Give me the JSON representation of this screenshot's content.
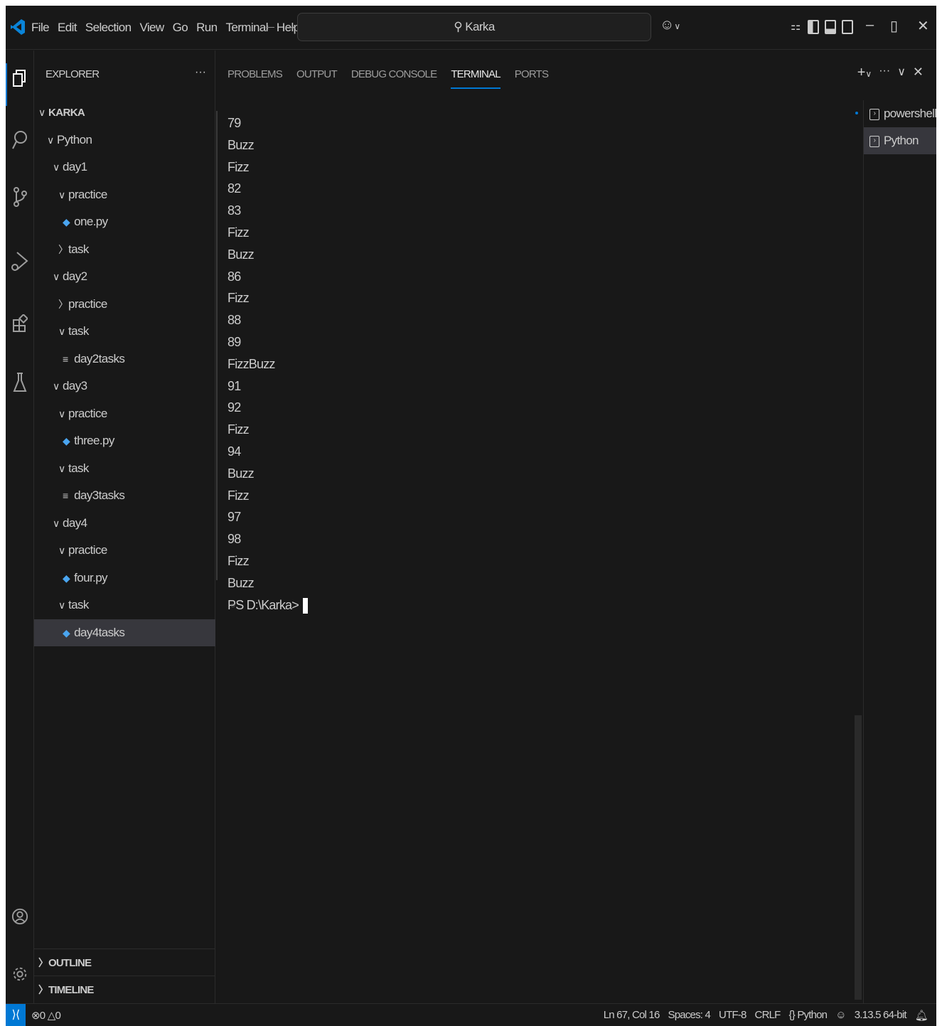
{
  "titlebar": {
    "menu": [
      "File",
      "Edit",
      "Selection",
      "View",
      "Go",
      "Run",
      "Terminal",
      "Help"
    ],
    "search_text": "Karka"
  },
  "sidebar": {
    "header": "EXPLORER",
    "tree": [
      {
        "label": "KARKA",
        "depth": 0,
        "kind": "root",
        "chevron": "∨"
      },
      {
        "label": "Python",
        "depth": 1,
        "kind": "folder",
        "chevron": "∨"
      },
      {
        "label": "day1",
        "depth": 2,
        "kind": "folder",
        "chevron": "∨"
      },
      {
        "label": "practice",
        "depth": 3,
        "kind": "folder",
        "chevron": "∨"
      },
      {
        "label": "one.py",
        "depth": 4,
        "kind": "py"
      },
      {
        "label": "task",
        "depth": 3,
        "kind": "folder",
        "chevron": "〉"
      },
      {
        "label": "day2",
        "depth": 2,
        "kind": "folder",
        "chevron": "∨"
      },
      {
        "label": "practice",
        "depth": 3,
        "kind": "folder",
        "chevron": "〉"
      },
      {
        "label": "task",
        "depth": 3,
        "kind": "folder",
        "chevron": "∨"
      },
      {
        "label": "day2tasks",
        "depth": 4,
        "kind": "txt"
      },
      {
        "label": "day3",
        "depth": 2,
        "kind": "folder",
        "chevron": "∨"
      },
      {
        "label": "practice",
        "depth": 3,
        "kind": "folder",
        "chevron": "∨"
      },
      {
        "label": "three.py",
        "depth": 4,
        "kind": "py"
      },
      {
        "label": "task",
        "depth": 3,
        "kind": "folder",
        "chevron": "∨"
      },
      {
        "label": "day3tasks",
        "depth": 4,
        "kind": "txt"
      },
      {
        "label": "day4",
        "depth": 2,
        "kind": "folder",
        "chevron": "∨"
      },
      {
        "label": "practice",
        "depth": 3,
        "kind": "folder",
        "chevron": "∨"
      },
      {
        "label": "four.py",
        "depth": 4,
        "kind": "py"
      },
      {
        "label": "task",
        "depth": 3,
        "kind": "folder",
        "chevron": "∨"
      },
      {
        "label": "day4tasks",
        "depth": 4,
        "kind": "py",
        "selected": true
      }
    ],
    "outline_label": "OUTLINE",
    "timeline_label": "TIMELINE"
  },
  "panel": {
    "tabs": [
      {
        "label": "PROBLEMS",
        "active": false
      },
      {
        "label": "OUTPUT",
        "active": false
      },
      {
        "label": "DEBUG CONSOLE",
        "active": false
      },
      {
        "label": "TERMINAL",
        "active": true
      },
      {
        "label": "PORTS",
        "active": false
      }
    ],
    "terminal_lines": [
      "79",
      "Buzz",
      "Fizz",
      "82",
      "83",
      "Fizz",
      "Buzz",
      "86",
      "Fizz",
      "88",
      "89",
      "FizzBuzz",
      "91",
      "92",
      "Fizz",
      "94",
      "Buzz",
      "Fizz",
      "97",
      "98",
      "Fizz",
      "Buzz"
    ],
    "prompt": "PS D:\\Karka>",
    "terminals": [
      {
        "label": "powershell",
        "selected": false
      },
      {
        "label": "Python",
        "selected": true
      }
    ]
  },
  "statusbar": {
    "errors": "0",
    "warnings": "0",
    "position": "Ln 67, Col 16",
    "spaces": "Spaces: 4",
    "encoding": "UTF-8",
    "eol": "CRLF",
    "language": "Python",
    "interpreter": "3.13.5 64-bit"
  },
  "colors": {
    "background": "#181818",
    "accent": "#0078d4",
    "selection": "#37373d",
    "text": "#cccccc"
  }
}
